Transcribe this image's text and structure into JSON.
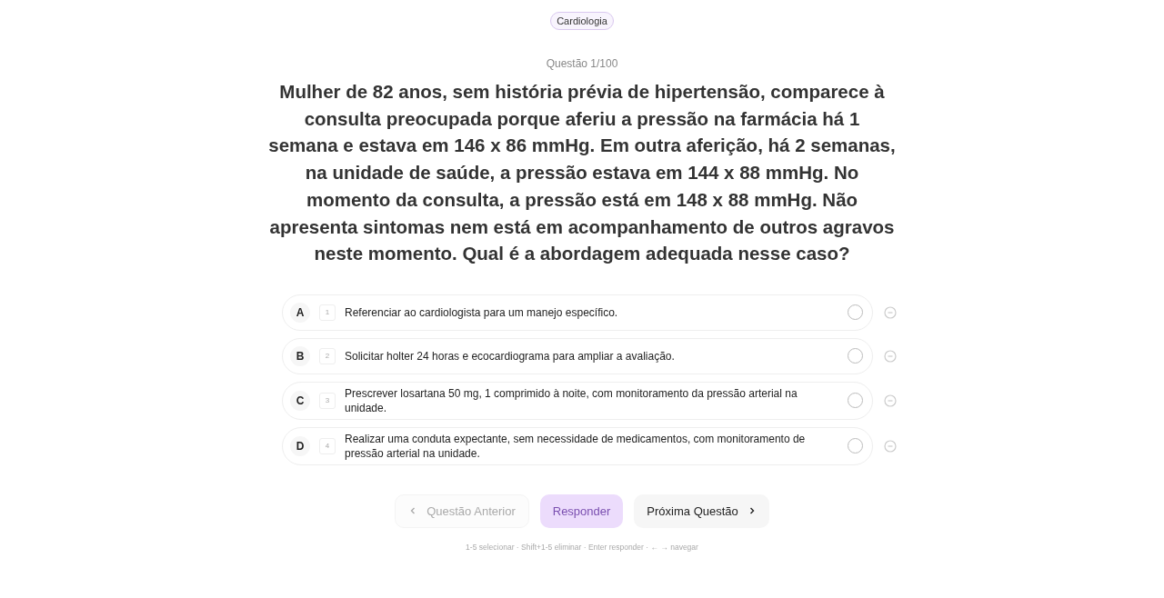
{
  "tag": "Cardiologia",
  "counter": "Questão 1/100",
  "question": "Mulher de 82 anos, sem história prévia de hipertensão, comparece à consulta preocupada porque aferiu a pressão na farmácia há 1 semana e estava em 146 x 86 mmHg. Em outra aferição, há 2 semanas, na unidade de saúde, a pressão estava em 144 x 88 mmHg. No momento da consulta, a pressão está em 148 x 88 mmHg. Não apresenta sintomas nem está em acompanhamento de outros agravos neste momento. Qual é a abordagem adequada nesse caso?",
  "options": [
    {
      "letter": "A",
      "key": "1",
      "text": "Referenciar ao cardiologista para um manejo específico.",
      "selected": false,
      "eliminated": false
    },
    {
      "letter": "B",
      "key": "2",
      "text": "Solicitar holter 24 horas e ecocardiograma para ampliar a avaliação.",
      "selected": false,
      "eliminated": false
    },
    {
      "letter": "C",
      "key": "3",
      "text": "Prescrever losartana 50 mg, 1 comprimido à noite, com monitoramento da pressão arterial na unidade.",
      "selected": false,
      "eliminated": false
    },
    {
      "letter": "D",
      "key": "4",
      "text": "Realizar uma conduta expectante, sem necessidade de medicamentos, com monitoramento de pressão arterial na unidade.",
      "selected": false,
      "eliminated": false
    }
  ],
  "buttons": [
    {
      "kind": "prev",
      "label": "Questão Anterior",
      "disabled": true
    },
    {
      "kind": "answer",
      "label": "Responder",
      "disabled": true
    },
    {
      "kind": "next",
      "label": "Próxima Questão",
      "disabled": false
    }
  ],
  "shortcuts": "1-5 selecionar · Shift+1-5 eliminar · Enter responder · ← → navegar"
}
